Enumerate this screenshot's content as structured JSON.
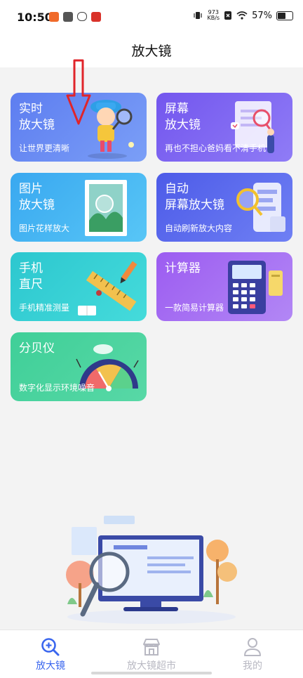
{
  "status_bar": {
    "time": "10:50",
    "net_speed_value": "973",
    "net_speed_unit": "KB/s",
    "battery": "57%"
  },
  "header": {
    "title": "放大镜"
  },
  "cards": [
    {
      "title": "实时\n放大镜",
      "subtitle": "让世界更清晰"
    },
    {
      "title": "屏幕\n放大镜",
      "subtitle": "再也不担心爸妈看不清手机"
    },
    {
      "title": "图片\n放大镜",
      "subtitle": "图片花样放大"
    },
    {
      "title": "自动\n屏幕放大镜",
      "subtitle": "自动刷新放大内容"
    },
    {
      "title": "手机\n直尺",
      "subtitle": "手机精准测量"
    },
    {
      "title": "计算器",
      "subtitle": "一款简易计算器"
    },
    {
      "title": "分贝仪",
      "subtitle": "数字化显示环境噪音"
    }
  ],
  "bottom_nav": {
    "items": [
      {
        "label": "放大镜",
        "icon": "magnifier-plus-icon",
        "active": true
      },
      {
        "label": "放大镜超市",
        "icon": "store-icon",
        "active": false
      },
      {
        "label": "我的",
        "icon": "user-icon",
        "active": false
      }
    ]
  },
  "colors": {
    "accent": "#3a66ee",
    "nav_inactive": "#b8b8c2",
    "annotation_arrow": "#e0242a"
  }
}
